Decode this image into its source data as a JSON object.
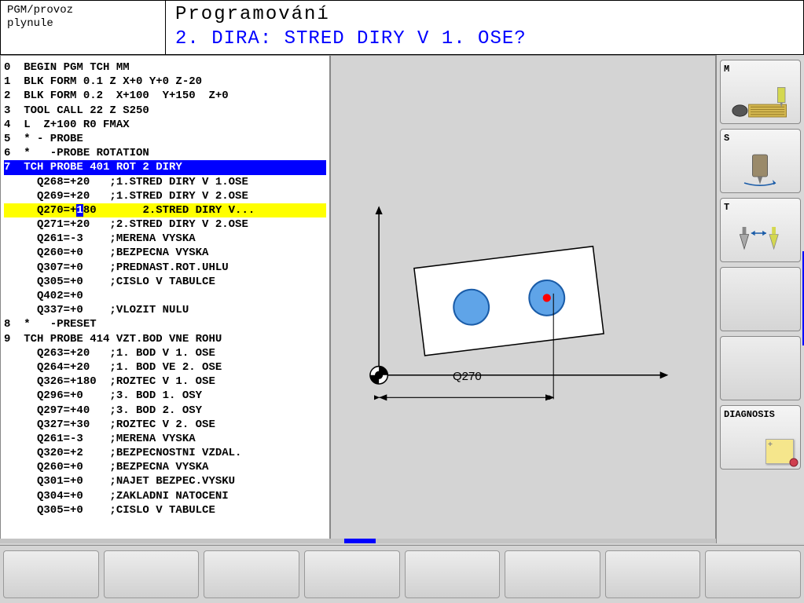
{
  "mode": {
    "line1": "PGM/provoz",
    "line2": "plynule"
  },
  "title": {
    "main": "Programování",
    "sub": "2. DIRA: STRED DIRY V 1. OSE?"
  },
  "code": {
    "lines": [
      {
        "n": "0",
        "t": "  BEGIN PGM TCH MM"
      },
      {
        "n": "1",
        "t": "  BLK FORM 0.1 Z X+0 Y+0 Z-20"
      },
      {
        "n": "2",
        "t": "  BLK FORM 0.2  X+100  Y+150  Z+0"
      },
      {
        "n": "3",
        "t": "  TOOL CALL 22 Z S250"
      },
      {
        "n": "4",
        "t": "  L  Z+100 R0 FMAX"
      },
      {
        "n": "5",
        "t": "  * - PROBE"
      },
      {
        "n": "6",
        "t": "  *   -PROBE ROTATION"
      },
      {
        "n": "7",
        "t": "  TCH PROBE 401 ROT 2 DIRY",
        "sel": true
      },
      {
        "n": "",
        "t": "    Q268=+20   ;1.STRED DIRY V 1.OSE"
      },
      {
        "n": "",
        "t": "    Q269=+20   ;1.STRED DIRY V 2.OSE"
      },
      {
        "n": "",
        "t": "    Q270=+",
        "c": "1",
        "t2": "80       2.STRED DIRY V...",
        "hl": true
      },
      {
        "n": "",
        "t": "    Q271=+20   ;2.STRED DIRY V 2.OSE"
      },
      {
        "n": "",
        "t": "    Q261=-3    ;MERENA VYSKA"
      },
      {
        "n": "",
        "t": "    Q260=+0    ;BEZPECNA VYSKA"
      },
      {
        "n": "",
        "t": "    Q307=+0    ;PREDNAST.ROT.UHLU"
      },
      {
        "n": "",
        "t": "    Q305=+0    ;CISLO V TABULCE"
      },
      {
        "n": "",
        "t": "    Q402=+0"
      },
      {
        "n": "",
        "t": "    Q337=+0    ;VLOZIT NULU"
      },
      {
        "n": "8",
        "t": "  *   -PRESET"
      },
      {
        "n": "9",
        "t": "  TCH PROBE 414 VZT.BOD VNE ROHU"
      },
      {
        "n": "",
        "t": "    Q263=+20   ;1. BOD V 1. OSE"
      },
      {
        "n": "",
        "t": "    Q264=+20   ;1. BOD VE 2. OSE"
      },
      {
        "n": "",
        "t": "    Q326=+180  ;ROZTEC V 1. OSE"
      },
      {
        "n": "",
        "t": "    Q296=+0    ;3. BOD 1. OSY"
      },
      {
        "n": "",
        "t": "    Q297=+40   ;3. BOD 2. OSY"
      },
      {
        "n": "",
        "t": "    Q327=+30   ;ROZTEC V 2. OSE"
      },
      {
        "n": "",
        "t": "    Q261=-3    ;MERENA VYSKA"
      },
      {
        "n": "",
        "t": "    Q320=+2    ;BEZPECNOSTNI VZDAL."
      },
      {
        "n": "",
        "t": "    Q260=+0    ;BEZPECNA VYSKA"
      },
      {
        "n": "",
        "t": "    Q301=+0    ;NAJET BEZPEC.VYSKU"
      },
      {
        "n": "",
        "t": "    Q304=+0    ;ZAKLADNI NATOCENI"
      },
      {
        "n": "",
        "t": "    Q305=+0    ;CISLO V TABULCE"
      }
    ]
  },
  "graphic": {
    "axis_label": "Q270"
  },
  "side": {
    "buttons": [
      {
        "label": "M",
        "icon": "machine"
      },
      {
        "label": "S",
        "icon": "spindle"
      },
      {
        "label": "T",
        "icon": "tool"
      },
      {
        "label": "",
        "icon": ""
      },
      {
        "label": "",
        "icon": ""
      },
      {
        "label": "DIAGNOSIS",
        "icon": "note"
      }
    ]
  },
  "softkeys": [
    "",
    "",
    "",
    "",
    "",
    "",
    "",
    ""
  ]
}
